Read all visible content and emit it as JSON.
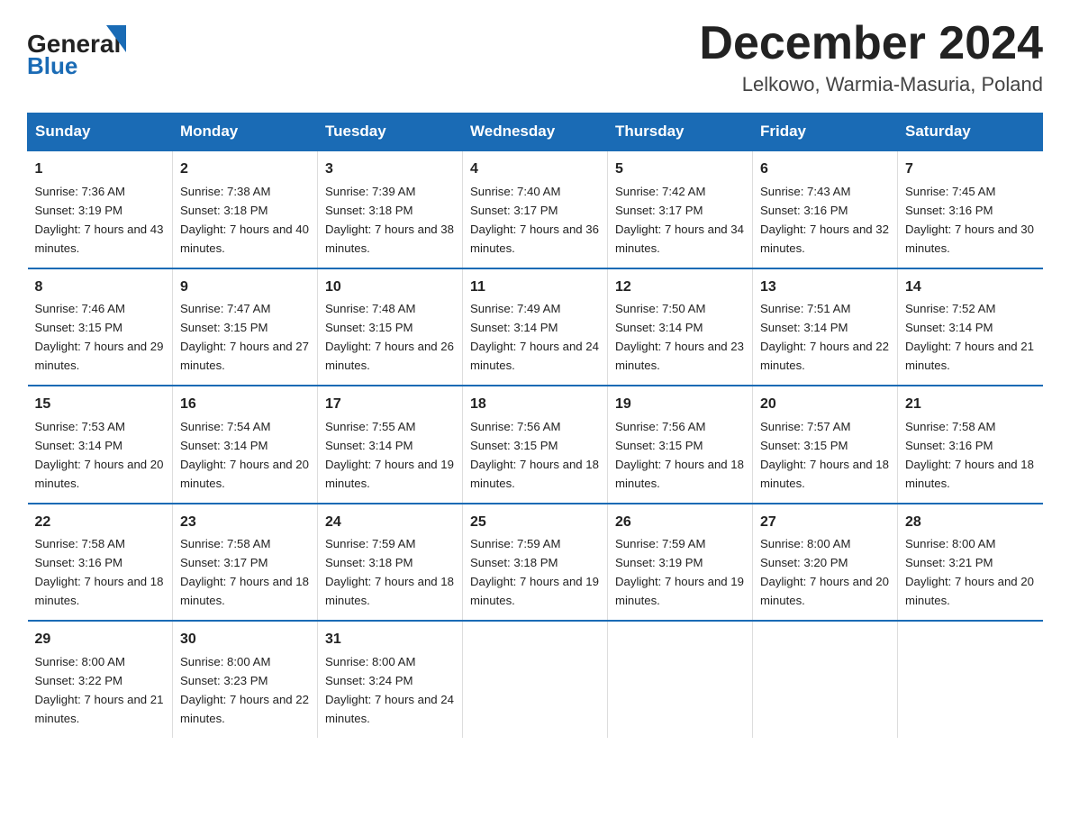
{
  "header": {
    "logo": {
      "general": "General",
      "blue": "Blue"
    },
    "title": "December 2024",
    "location": "Lelkowo, Warmia-Masuria, Poland"
  },
  "days_of_week": [
    "Sunday",
    "Monday",
    "Tuesday",
    "Wednesday",
    "Thursday",
    "Friday",
    "Saturday"
  ],
  "weeks": [
    [
      {
        "day": "1",
        "sunrise": "Sunrise: 7:36 AM",
        "sunset": "Sunset: 3:19 PM",
        "daylight": "Daylight: 7 hours and 43 minutes."
      },
      {
        "day": "2",
        "sunrise": "Sunrise: 7:38 AM",
        "sunset": "Sunset: 3:18 PM",
        "daylight": "Daylight: 7 hours and 40 minutes."
      },
      {
        "day": "3",
        "sunrise": "Sunrise: 7:39 AM",
        "sunset": "Sunset: 3:18 PM",
        "daylight": "Daylight: 7 hours and 38 minutes."
      },
      {
        "day": "4",
        "sunrise": "Sunrise: 7:40 AM",
        "sunset": "Sunset: 3:17 PM",
        "daylight": "Daylight: 7 hours and 36 minutes."
      },
      {
        "day": "5",
        "sunrise": "Sunrise: 7:42 AM",
        "sunset": "Sunset: 3:17 PM",
        "daylight": "Daylight: 7 hours and 34 minutes."
      },
      {
        "day": "6",
        "sunrise": "Sunrise: 7:43 AM",
        "sunset": "Sunset: 3:16 PM",
        "daylight": "Daylight: 7 hours and 32 minutes."
      },
      {
        "day": "7",
        "sunrise": "Sunrise: 7:45 AM",
        "sunset": "Sunset: 3:16 PM",
        "daylight": "Daylight: 7 hours and 30 minutes."
      }
    ],
    [
      {
        "day": "8",
        "sunrise": "Sunrise: 7:46 AM",
        "sunset": "Sunset: 3:15 PM",
        "daylight": "Daylight: 7 hours and 29 minutes."
      },
      {
        "day": "9",
        "sunrise": "Sunrise: 7:47 AM",
        "sunset": "Sunset: 3:15 PM",
        "daylight": "Daylight: 7 hours and 27 minutes."
      },
      {
        "day": "10",
        "sunrise": "Sunrise: 7:48 AM",
        "sunset": "Sunset: 3:15 PM",
        "daylight": "Daylight: 7 hours and 26 minutes."
      },
      {
        "day": "11",
        "sunrise": "Sunrise: 7:49 AM",
        "sunset": "Sunset: 3:14 PM",
        "daylight": "Daylight: 7 hours and 24 minutes."
      },
      {
        "day": "12",
        "sunrise": "Sunrise: 7:50 AM",
        "sunset": "Sunset: 3:14 PM",
        "daylight": "Daylight: 7 hours and 23 minutes."
      },
      {
        "day": "13",
        "sunrise": "Sunrise: 7:51 AM",
        "sunset": "Sunset: 3:14 PM",
        "daylight": "Daylight: 7 hours and 22 minutes."
      },
      {
        "day": "14",
        "sunrise": "Sunrise: 7:52 AM",
        "sunset": "Sunset: 3:14 PM",
        "daylight": "Daylight: 7 hours and 21 minutes."
      }
    ],
    [
      {
        "day": "15",
        "sunrise": "Sunrise: 7:53 AM",
        "sunset": "Sunset: 3:14 PM",
        "daylight": "Daylight: 7 hours and 20 minutes."
      },
      {
        "day": "16",
        "sunrise": "Sunrise: 7:54 AM",
        "sunset": "Sunset: 3:14 PM",
        "daylight": "Daylight: 7 hours and 20 minutes."
      },
      {
        "day": "17",
        "sunrise": "Sunrise: 7:55 AM",
        "sunset": "Sunset: 3:14 PM",
        "daylight": "Daylight: 7 hours and 19 minutes."
      },
      {
        "day": "18",
        "sunrise": "Sunrise: 7:56 AM",
        "sunset": "Sunset: 3:15 PM",
        "daylight": "Daylight: 7 hours and 18 minutes."
      },
      {
        "day": "19",
        "sunrise": "Sunrise: 7:56 AM",
        "sunset": "Sunset: 3:15 PM",
        "daylight": "Daylight: 7 hours and 18 minutes."
      },
      {
        "day": "20",
        "sunrise": "Sunrise: 7:57 AM",
        "sunset": "Sunset: 3:15 PM",
        "daylight": "Daylight: 7 hours and 18 minutes."
      },
      {
        "day": "21",
        "sunrise": "Sunrise: 7:58 AM",
        "sunset": "Sunset: 3:16 PM",
        "daylight": "Daylight: 7 hours and 18 minutes."
      }
    ],
    [
      {
        "day": "22",
        "sunrise": "Sunrise: 7:58 AM",
        "sunset": "Sunset: 3:16 PM",
        "daylight": "Daylight: 7 hours and 18 minutes."
      },
      {
        "day": "23",
        "sunrise": "Sunrise: 7:58 AM",
        "sunset": "Sunset: 3:17 PM",
        "daylight": "Daylight: 7 hours and 18 minutes."
      },
      {
        "day": "24",
        "sunrise": "Sunrise: 7:59 AM",
        "sunset": "Sunset: 3:18 PM",
        "daylight": "Daylight: 7 hours and 18 minutes."
      },
      {
        "day": "25",
        "sunrise": "Sunrise: 7:59 AM",
        "sunset": "Sunset: 3:18 PM",
        "daylight": "Daylight: 7 hours and 19 minutes."
      },
      {
        "day": "26",
        "sunrise": "Sunrise: 7:59 AM",
        "sunset": "Sunset: 3:19 PM",
        "daylight": "Daylight: 7 hours and 19 minutes."
      },
      {
        "day": "27",
        "sunrise": "Sunrise: 8:00 AM",
        "sunset": "Sunset: 3:20 PM",
        "daylight": "Daylight: 7 hours and 20 minutes."
      },
      {
        "day": "28",
        "sunrise": "Sunrise: 8:00 AM",
        "sunset": "Sunset: 3:21 PM",
        "daylight": "Daylight: 7 hours and 20 minutes."
      }
    ],
    [
      {
        "day": "29",
        "sunrise": "Sunrise: 8:00 AM",
        "sunset": "Sunset: 3:22 PM",
        "daylight": "Daylight: 7 hours and 21 minutes."
      },
      {
        "day": "30",
        "sunrise": "Sunrise: 8:00 AM",
        "sunset": "Sunset: 3:23 PM",
        "daylight": "Daylight: 7 hours and 22 minutes."
      },
      {
        "day": "31",
        "sunrise": "Sunrise: 8:00 AM",
        "sunset": "Sunset: 3:24 PM",
        "daylight": "Daylight: 7 hours and 24 minutes."
      },
      null,
      null,
      null,
      null
    ]
  ]
}
